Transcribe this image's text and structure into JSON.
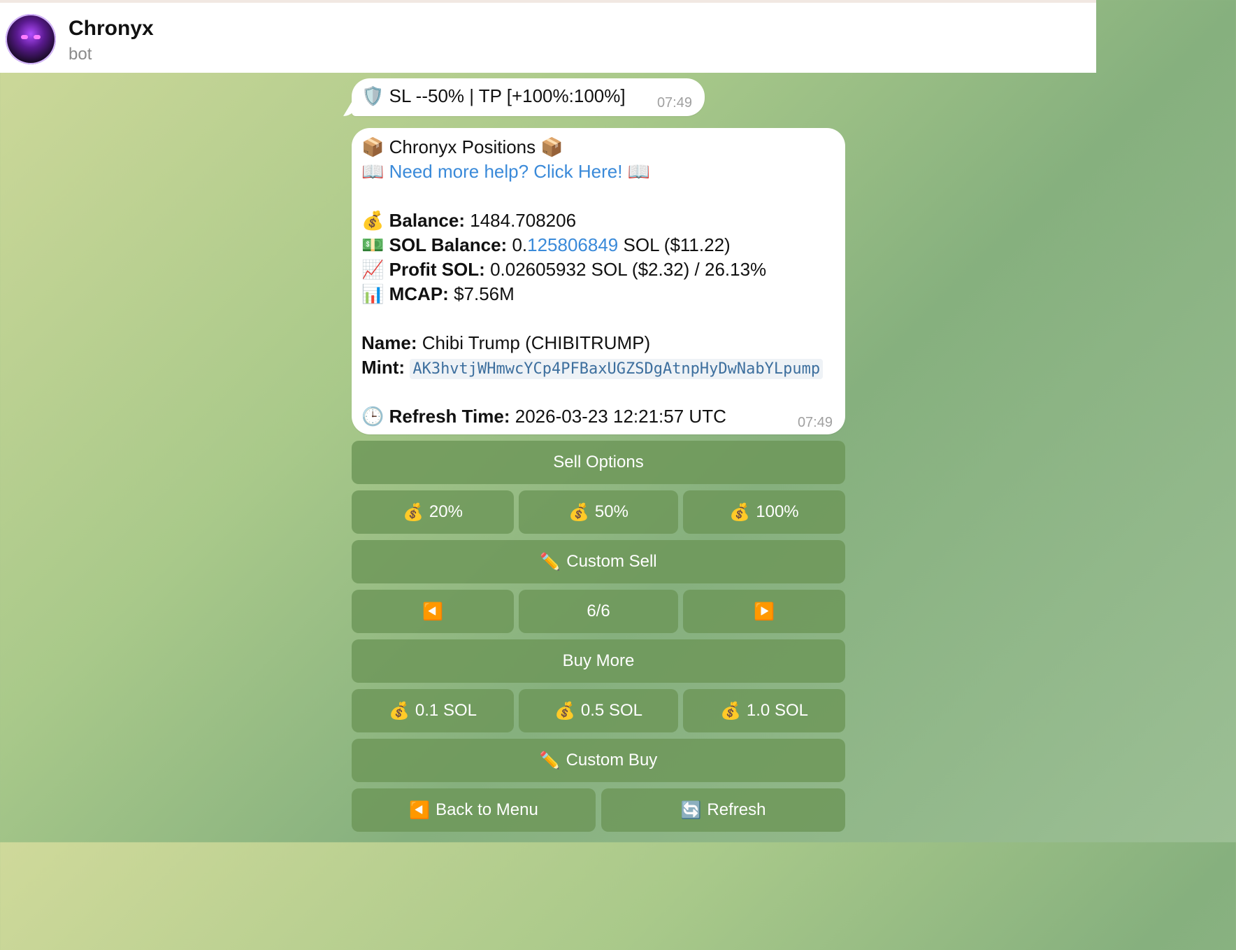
{
  "header": {
    "title": "Chronyx",
    "subtitle": "bot"
  },
  "messages": {
    "sl_tp": {
      "icon": "🛡️",
      "text": "SL --50% | TP [+100%:100%]",
      "time": "07:49"
    },
    "positions": {
      "title_icon": "📦",
      "title": "Chronyx Positions",
      "help_icon": "📖",
      "help_link": "Need more help? Click Here!",
      "balance_icon": "💰",
      "balance_label": "Balance:",
      "balance_value": "1484.708206",
      "sol_icon": "💵",
      "sol_label": "SOL Balance:",
      "sol_value_prefix": "0.",
      "sol_value_link": "125806849",
      "sol_value_suffix": "SOL ($11.22)",
      "profit_icon": "📈",
      "profit_label": "Profit SOL:",
      "profit_value": "0.02605932 SOL ($2.32) / 26.13%",
      "mcap_icon": "📊",
      "mcap_label": "MCAP:",
      "mcap_value": "$7.56M",
      "name_label": "Name:",
      "name_value": "Chibi Trump (CHIBITRUMP)",
      "mint_label": "Mint:",
      "mint_value": "AK3hvtjWHmwcYCp4PFBaxUGZSDgAtnpHyDwNabYLpump",
      "refresh_icon": "🕒",
      "refresh_label": "Refresh Time:",
      "refresh_value": "2026-03-23 12:21:57 UTC",
      "time": "07:49"
    }
  },
  "keyboard": {
    "sell_options": "Sell Options",
    "money_icon": "💰",
    "pencil_icon": "✏️",
    "sell_20": "20%",
    "sell_50": "50%",
    "sell_100": "100%",
    "custom_sell": "Custom Sell",
    "prev_icon": "◀️",
    "page": "6/6",
    "next_icon": "▶️",
    "buy_more": "Buy More",
    "buy_01": "0.1 SOL",
    "buy_05": "0.5 SOL",
    "buy_10": "1.0 SOL",
    "custom_buy": "Custom Buy",
    "back_icon": "◀️",
    "back_to_menu": "Back to Menu",
    "refresh_icon": "🔄",
    "refresh": "Refresh"
  }
}
